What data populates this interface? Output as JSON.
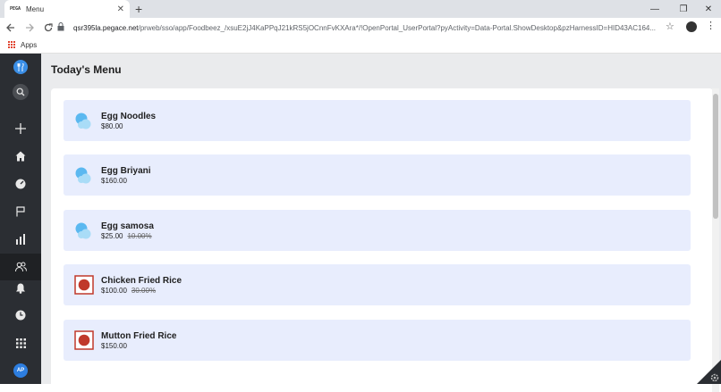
{
  "browser": {
    "tab_title": "Menu",
    "tab_favicon_text": "PEGA",
    "url_host": "qsr395la.pegace.net",
    "url_rest": "/prweb/sso/app/Foodbeez_/xsuE2jJ4KaPPqJ21kRS5jOCnnFvKXAra*/!OpenPortal_UserPortal?pyActivity=Data-Portal.ShowDesktop&pzHarnessID=HID43AC164...",
    "bookmarks_apps": "Apps"
  },
  "sidebar": {
    "avatar_initials": "AP",
    "icons": [
      "app-logo-icon",
      "search-icon",
      "plus-icon",
      "home-icon",
      "dashboard-icon",
      "flag-icon",
      "bar-chart-icon",
      "users-icon",
      "bell-icon",
      "clock-icon",
      "grid-icon",
      "avatar"
    ]
  },
  "page": {
    "title": "Today's Menu"
  },
  "menu": [
    {
      "name": "Egg Noodles",
      "price": "$80.00",
      "old": "",
      "icon": "cloud-icon"
    },
    {
      "name": "Egg Briyani",
      "price": "$160.00",
      "old": "",
      "icon": "cloud-icon"
    },
    {
      "name": "Egg samosa",
      "price": "$25.00",
      "old": "10.00%",
      "icon": "cloud-icon"
    },
    {
      "name": "Chicken Fried Rice",
      "price": "$100.00",
      "old": "30.00%",
      "icon": "non-veg-icon"
    },
    {
      "name": "Mutton Fried Rice",
      "price": "$150.00",
      "old": "",
      "icon": "non-veg-icon"
    }
  ],
  "colors": {
    "sidebar": "#2b2e33",
    "card": "#e8edfd",
    "non_veg": "#c0392b",
    "cloud": "#5bb8f0"
  }
}
